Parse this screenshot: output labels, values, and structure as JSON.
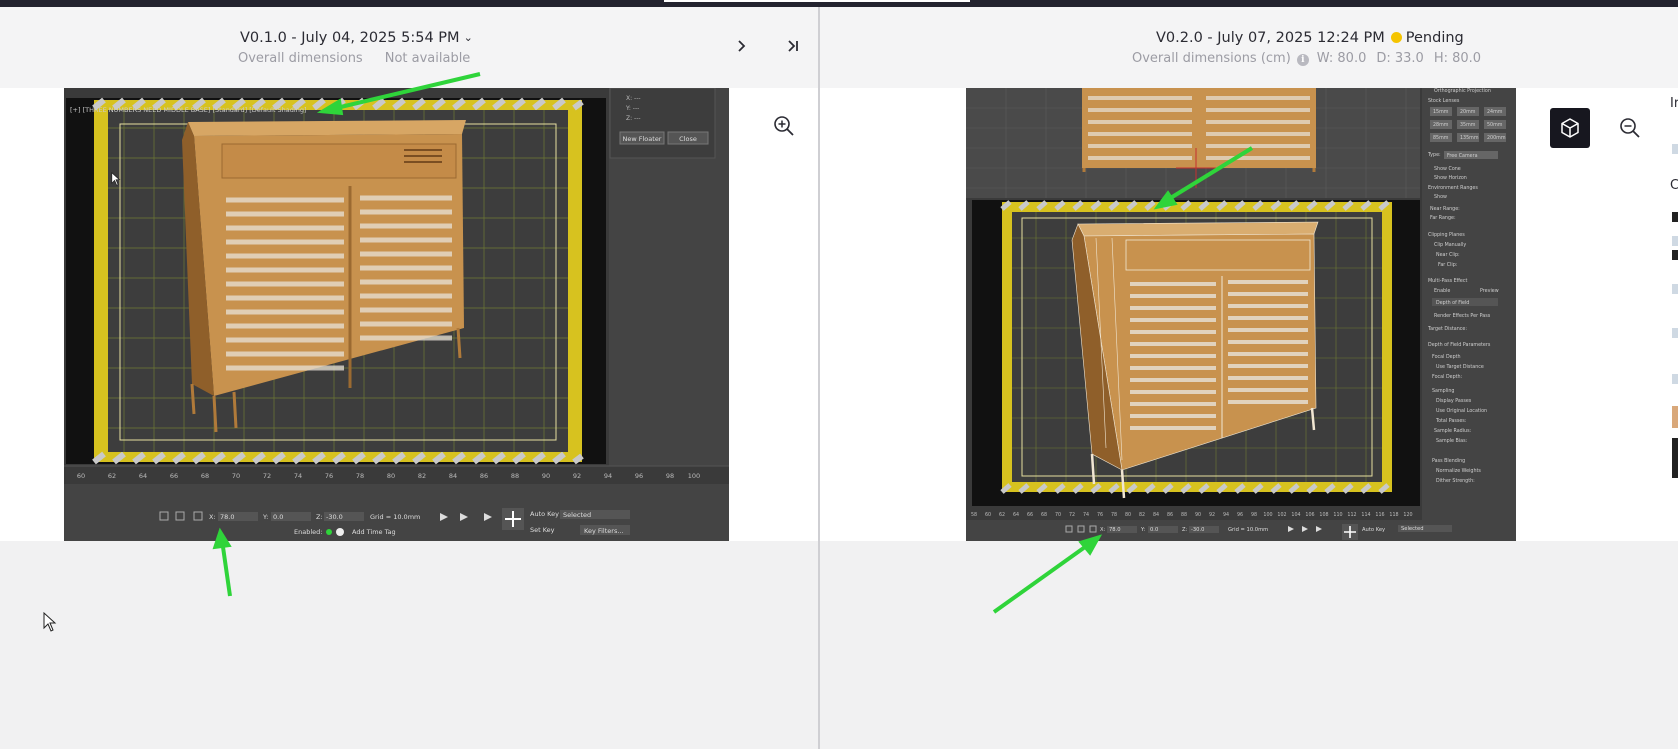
{
  "left_pane": {
    "title": "V0.1.0 - July 04, 2025 5:54 PM",
    "subtitle_label": "Overall dimensions",
    "subtitle_value": "Not available",
    "viewport": {
      "viewport_label": "[+] [THREE NUMBERS NEED MIDDLE BASE] [Standard] [Default Shading]",
      "panel_buttons": [
        "New Floater",
        "Close"
      ],
      "coords": {
        "x_label": "X:",
        "x": "78.0",
        "y_label": "Y:",
        "y": "0.0",
        "z_label": "Z:",
        "z": "-30.0"
      },
      "grid": "Grid = 10.0mm",
      "enabled_label": "Enabled:",
      "add_time_tag": "Add Time Tag",
      "auto_key": "Auto Key",
      "set_key": "Set Key",
      "key_mode": "Selected",
      "key_filters": "Key Filters...",
      "timeline_ticks": [
        "60",
        "62",
        "64",
        "66",
        "68",
        "70",
        "72",
        "74",
        "76",
        "78",
        "80",
        "82",
        "84",
        "86",
        "88",
        "90",
        "92",
        "94",
        "96",
        "98",
        "100"
      ]
    }
  },
  "right_pane": {
    "title": "V0.2.0 - July 07, 2025 12:24 PM",
    "status": "Pending",
    "subtitle_label": "Overall dimensions (cm)",
    "width": "W: 80.0",
    "depth": "D: 33.0",
    "height": "H: 80.0",
    "side_label_1": "Ir",
    "side_label_2": "C",
    "viewport": {
      "coords": {
        "x_label": "X:",
        "x": "78.0",
        "y_label": "Y:",
        "y": "0.0",
        "z_label": "Z:",
        "z": "-30.0"
      },
      "grid": "Grid = 10.0mm",
      "auto_key": "Auto Key",
      "key_mode": "Selected",
      "panel_sections": [
        "Orthographic Projection",
        "Stock Lenses",
        "Type:",
        "Show Cone",
        "Show Horizon",
        "Environment Ranges",
        "Show",
        "Near Range:",
        "Far Range:",
        "Clipping Planes",
        "Clip Manually",
        "Near Clip:",
        "Far Clip:",
        "Multi-Pass Effect",
        "Enable",
        "Preview",
        "Depth of Field",
        "Render Effects Per Pass",
        "Target Distance:",
        "Depth of Field Parameters",
        "Focal Depth",
        "Use Target Distance",
        "Focal Depth:",
        "Sampling",
        "Display Passes",
        "Use Original Location",
        "Total Passes:",
        "Sample Radius:",
        "Sample Bias:",
        "Pass Blending",
        "Normalize Weights",
        "Dither Strength:"
      ],
      "lenses": [
        "15mm",
        "20mm",
        "24mm",
        "28mm",
        "35mm",
        "50mm",
        "85mm",
        "135mm",
        "200mm"
      ],
      "camera_type": "Free Camera",
      "timeline_ticks": [
        "58",
        "60",
        "62",
        "64",
        "66",
        "68",
        "70",
        "72",
        "74",
        "76",
        "78",
        "80",
        "82",
        "84",
        "86",
        "88",
        "90",
        "92",
        "94",
        "96",
        "98",
        "100",
        "102",
        "104",
        "106",
        "108",
        "110",
        "112",
        "114",
        "116",
        "118",
        "120"
      ]
    }
  },
  "colors": {
    "accent_arrow": "#2fd43a",
    "pending": "#f5c400",
    "wood": "#c8924e",
    "caution_yellow": "#d9c320"
  }
}
